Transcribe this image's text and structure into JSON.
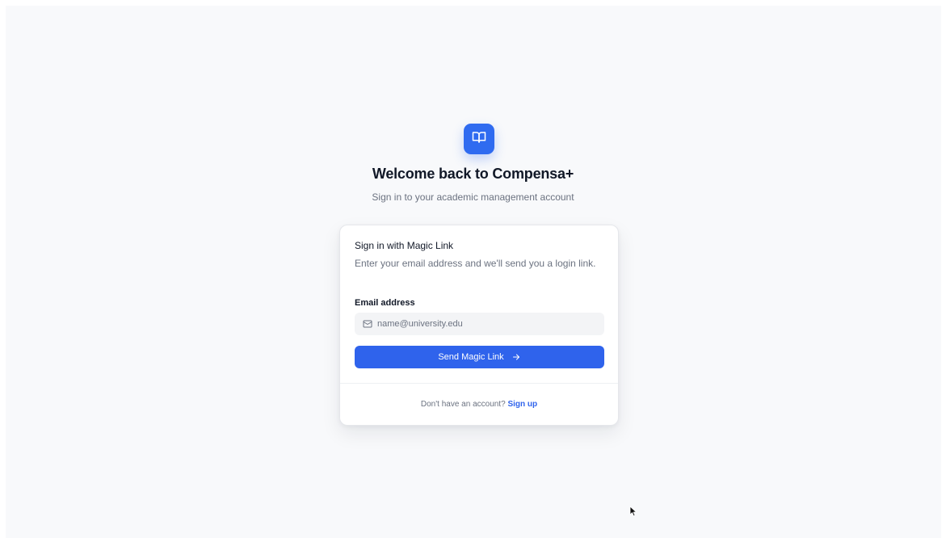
{
  "brand": {
    "icon": "book-open-icon",
    "accent_color": "#2f63ec"
  },
  "header": {
    "title": "Welcome back to Compensa+",
    "subtitle": "Sign in to your academic management account"
  },
  "card": {
    "title": "Sign in with Magic Link",
    "description": "Enter your email address and we'll send you a login link.",
    "email_label": "Email address",
    "email_placeholder": "name@university.edu",
    "email_value": "",
    "email_icon": "mail-icon",
    "submit_label": "Send Magic Link",
    "submit_icon": "arrow-right-icon"
  },
  "footer": {
    "prompt": "Don't have an account?",
    "signup_label": "Sign up"
  }
}
